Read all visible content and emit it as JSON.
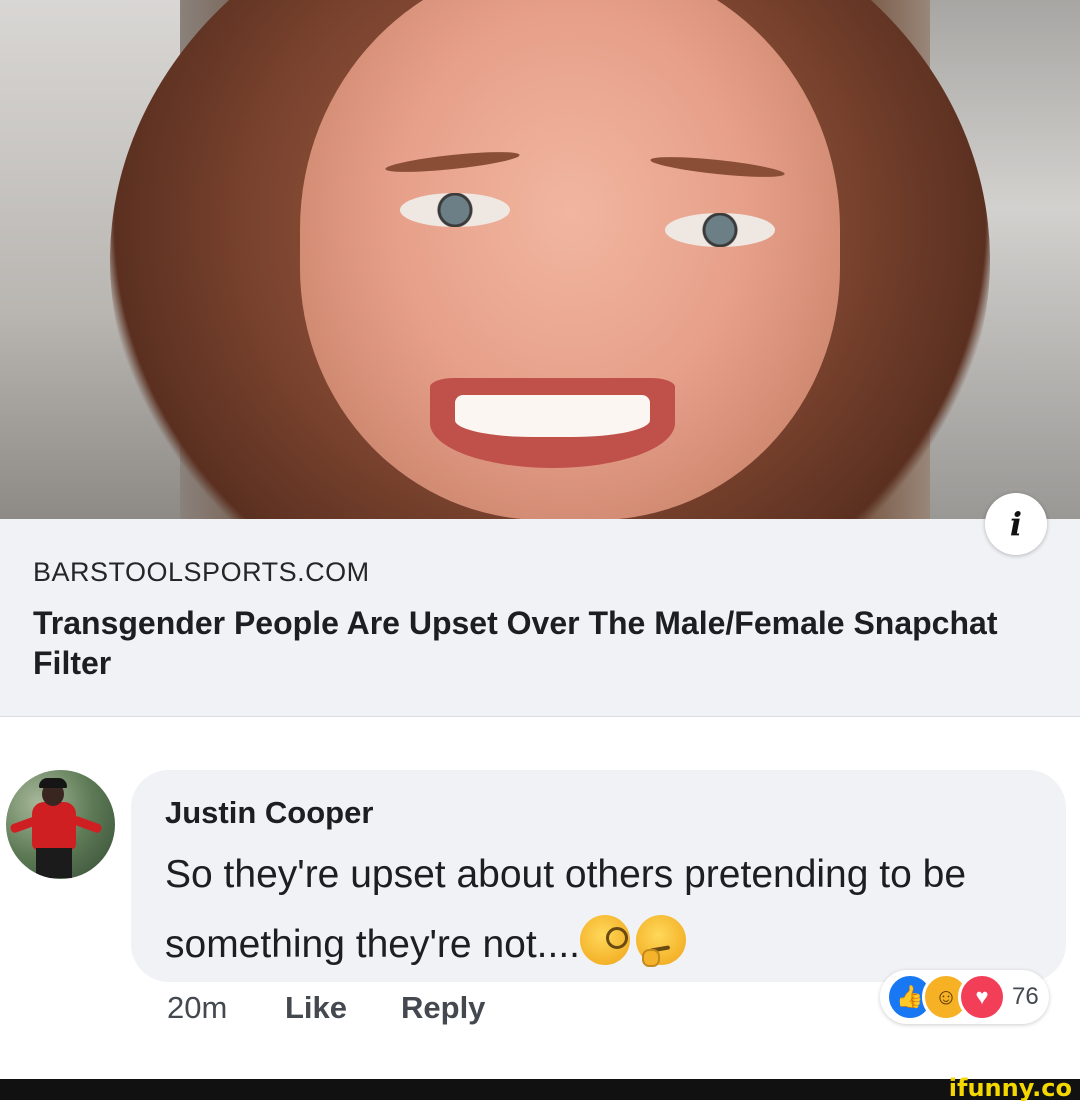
{
  "link_preview": {
    "domain": "BARSTOOLSPORTS.COM",
    "title": "Transgender People Are Upset Over The Male/Female Snapchat Filter",
    "info_icon": "info-icon"
  },
  "comment": {
    "author": "Justin Cooper",
    "text": "So they're upset about others pretending to be something they're not....",
    "emojis": [
      "face-with-monocle",
      "thinking-face"
    ],
    "timestamp": "20m",
    "like_label": "Like",
    "reply_label": "Reply",
    "reactions": {
      "icons": [
        "like",
        "haha",
        "love"
      ],
      "count": "76"
    }
  },
  "watermark": "ifunny.co",
  "colors": {
    "card_bg": "#f0f2f5",
    "like_blue": "#1877f2",
    "love_red": "#f33e58",
    "haha_yellow": "#f7b125",
    "watermark_yellow": "#f5d800"
  }
}
